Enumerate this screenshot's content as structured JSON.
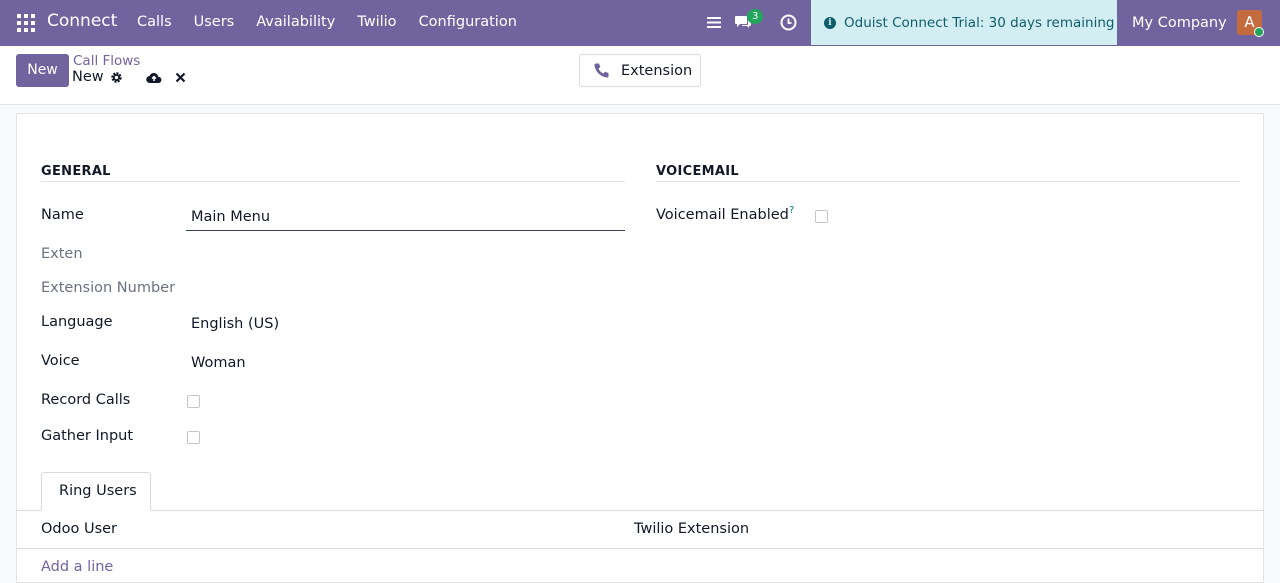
{
  "navbar": {
    "brand": "Connect",
    "menu": [
      "Calls",
      "Users",
      "Availability",
      "Twilio",
      "Configuration"
    ],
    "chat_count": "3",
    "trial_text": "Oduist Connect Trial: 30 days remaining",
    "company": "My Company",
    "avatar_initial": "A",
    "color": "#71639e"
  },
  "control": {
    "new_label": "New",
    "breadcrumb": "Call Flows",
    "record_name": "New",
    "extension_button": "Extension"
  },
  "form": {
    "general_title": "GENERAL",
    "voicemail_title": "VOICEMAIL",
    "name_label": "Name",
    "name_value": "Main Menu",
    "exten_label": "Exten",
    "extension_number_label": "Extension Number",
    "language_label": "Language",
    "language_value": "English (US)",
    "voice_label": "Voice",
    "voice_value": "Woman",
    "record_calls_label": "Record Calls",
    "gather_input_label": "Gather Input",
    "voicemail_enabled_label": "Voicemail Enabled",
    "help_mark": "?"
  },
  "tabs": {
    "ring_users": "Ring Users"
  },
  "table": {
    "headers": [
      "Odoo User",
      "Twilio Extension"
    ],
    "add_line": "Add a line"
  }
}
